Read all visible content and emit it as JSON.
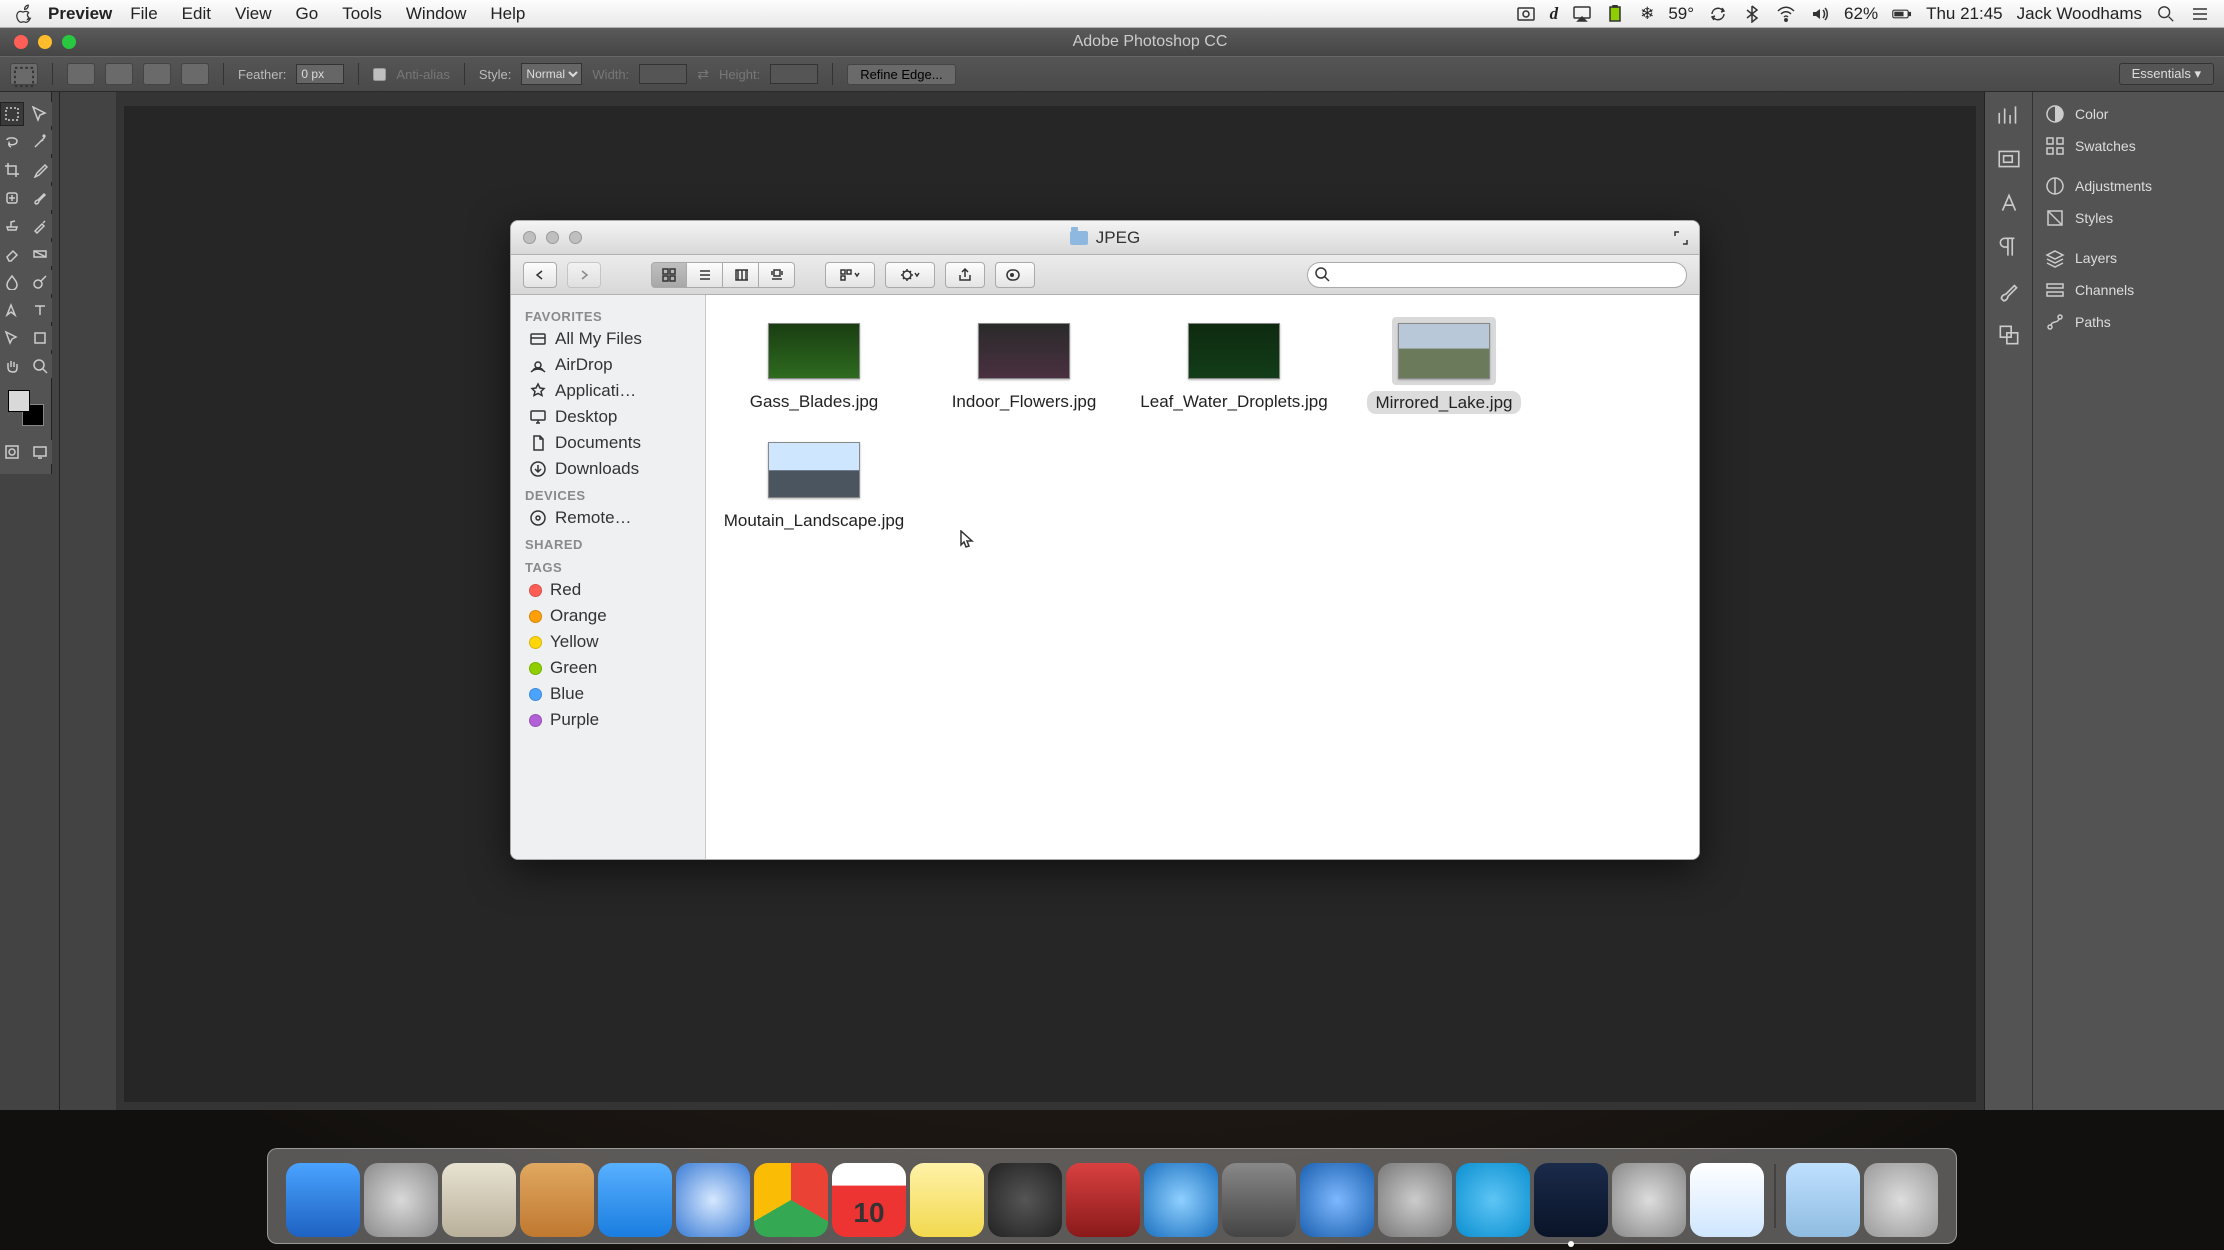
{
  "menubar": {
    "app": "Preview",
    "items": [
      "File",
      "Edit",
      "View",
      "Go",
      "Tools",
      "Window",
      "Help"
    ],
    "right": {
      "temp": "59°",
      "battery": "62%",
      "clock": "Thu 21:45",
      "user": "Jack Woodhams"
    }
  },
  "photoshop": {
    "title": "Adobe Photoshop CC",
    "options": {
      "feather_label": "Feather:",
      "feather_value": "0 px",
      "antialias_label": "Anti-alias",
      "style_label": "Style:",
      "style_value": "Normal",
      "width_label": "Width:",
      "height_label": "Height:",
      "refine": "Refine Edge...",
      "workspace": "Essentials"
    },
    "panels": [
      "Color",
      "Swatches",
      "Adjustments",
      "Styles",
      "Layers",
      "Channels",
      "Paths"
    ]
  },
  "finder": {
    "title": "JPEG",
    "search_placeholder": "",
    "sidebar": {
      "favorites_label": "FAVORITES",
      "favorites": [
        "All My Files",
        "AirDrop",
        "Applicati…",
        "Desktop",
        "Documents",
        "Downloads"
      ],
      "devices_label": "DEVICES",
      "devices": [
        "Remote…"
      ],
      "shared_label": "SHARED",
      "tags_label": "TAGS",
      "tags": [
        {
          "name": "Red",
          "color": "#ff5e56"
        },
        {
          "name": "Orange",
          "color": "#ff9f0a"
        },
        {
          "name": "Yellow",
          "color": "#ffd60a"
        },
        {
          "name": "Green",
          "color": "#8fce00"
        },
        {
          "name": "Blue",
          "color": "#4aa3ff"
        },
        {
          "name": "Purple",
          "color": "#b25fd8"
        }
      ]
    },
    "files": [
      {
        "name": "Gass_Blades.jpg",
        "thumb": "linear-gradient(#1a3d12,#2e6b1f)",
        "selected": false
      },
      {
        "name": "Indoor_Flowers.jpg",
        "thumb": "linear-gradient(#2a2a2a,#4a3040)",
        "selected": false
      },
      {
        "name": "Leaf_Water_Droplets.jpg",
        "thumb": "linear-gradient(#0e2a10,#123d18)",
        "selected": false
      },
      {
        "name": "Mirrored_Lake.jpg",
        "thumb": "linear-gradient(#b8c8d8 45%,#6a7a5a 46%)",
        "selected": true
      },
      {
        "name": "Moutain_Landscape.jpg",
        "thumb": "linear-gradient(#cfe6ff 50%,#4a5560 51%)",
        "selected": false
      }
    ]
  },
  "dock": {
    "items": [
      {
        "name": "finder",
        "bg": "linear-gradient(#4aa3ff,#1e62c2)"
      },
      {
        "name": "launchpad",
        "bg": "radial-gradient(circle,#d9d9d9,#8a8a8a)"
      },
      {
        "name": "mail",
        "bg": "linear-gradient(#e8e2d2,#b9b09a)"
      },
      {
        "name": "contacts",
        "bg": "linear-gradient(#e0a860,#c07830)"
      },
      {
        "name": "messages",
        "bg": "linear-gradient(#58b0ff,#1a7de0)"
      },
      {
        "name": "safari",
        "bg": "radial-gradient(circle,#d6e8ff,#3a7bd5)"
      },
      {
        "name": "chrome",
        "bg": "conic-gradient(#ea4335 0 120deg,#34a853 120deg 240deg,#fbbc05 240deg 360deg)"
      },
      {
        "name": "calendar",
        "bg": "linear-gradient(#fff 30%,#e33 31%)",
        "text": "10"
      },
      {
        "name": "notes",
        "bg": "linear-gradient(#fff2a8,#f2d94e)"
      },
      {
        "name": "facetime",
        "bg": "radial-gradient(circle,#555,#222)"
      },
      {
        "name": "photobooth",
        "bg": "linear-gradient(#d94040,#8a1a1a)"
      },
      {
        "name": "itunes",
        "bg": "radial-gradient(circle,#8fd0ff,#1a70c0)"
      },
      {
        "name": "garageband",
        "bg": "linear-gradient(#888,#444)"
      },
      {
        "name": "appstore",
        "bg": "radial-gradient(circle,#7db8ff,#1a5fae)"
      },
      {
        "name": "settings",
        "bg": "radial-gradient(circle,#ccc,#777)"
      },
      {
        "name": "skype",
        "bg": "radial-gradient(circle,#5ec5f5,#0a8fd0)"
      },
      {
        "name": "photoshop",
        "bg": "linear-gradient(#1a2a4a,#0a1428)",
        "active": true
      },
      {
        "name": "imovie",
        "bg": "radial-gradient(circle,#ddd,#888)"
      },
      {
        "name": "preview",
        "bg": "linear-gradient(#fff,#cfe6ff)"
      }
    ],
    "right_items": [
      {
        "name": "downloads",
        "bg": "linear-gradient(#bfe0ff,#8fbce0)"
      },
      {
        "name": "trash",
        "bg": "radial-gradient(circle,#ddd,#999)"
      }
    ]
  }
}
